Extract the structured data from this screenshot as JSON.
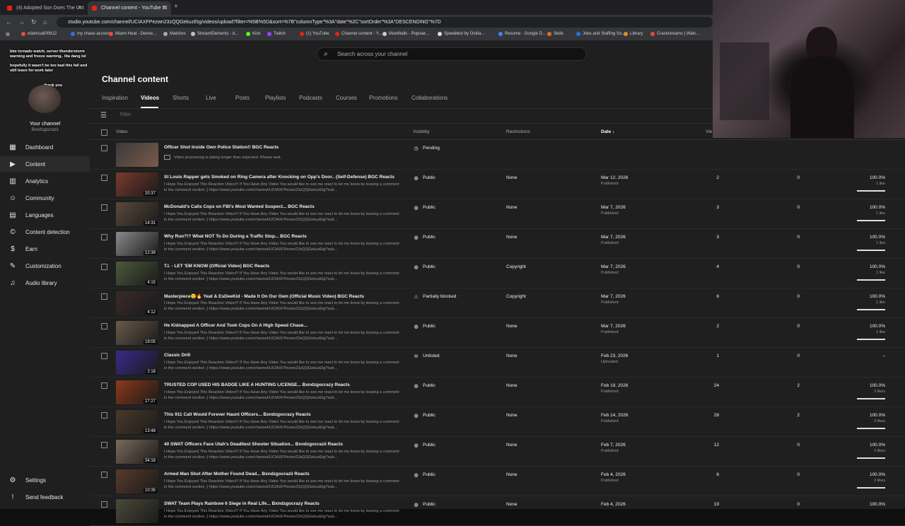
{
  "browser": {
    "tabs": [
      {
        "label": "(4) Adopted Son Does The Unt",
        "active": false
      },
      {
        "label": "Channel content - YouTube St",
        "active": true
      }
    ],
    "url": "studio.youtube.com/channel/UCIAXFPezwn23zQQGekuzEtg/videos/upload?filter=%5B%5D&sort=%7B\"columnType\"%3A\"date\"%2C\"sortOrder\"%3A\"DESCENDING\"%7D",
    "bookmarks": [
      "efabricati00912",
      "my chase account",
      "Miami Heat - Denve...",
      "Matches",
      "StreamElements - d...",
      "Kick",
      "Twitch",
      "(1) YouTube",
      "Channel content - Y...",
      "MoeWalls - Popular...",
      "Speedtest by Ookla...",
      "Resume - Google D...",
      "Skills",
      "Jobs and Staffing So...",
      "Library",
      "Crackstreams | Watc..."
    ]
  },
  "sidebar": {
    "channel_label": "Your channel",
    "channel_handle": "Bxndzgocrazii",
    "items": [
      {
        "label": "Dashboard",
        "icon": "dashboard-icon",
        "glyph": "▦"
      },
      {
        "label": "Content",
        "icon": "content-icon",
        "glyph": "▶",
        "active": true
      },
      {
        "label": "Analytics",
        "icon": "analytics-icon",
        "glyph": "▥"
      },
      {
        "label": "Community",
        "icon": "community-icon",
        "glyph": "☺"
      },
      {
        "label": "Languages",
        "icon": "languages-icon",
        "glyph": "▤"
      },
      {
        "label": "Content detection",
        "icon": "content-detection-icon",
        "glyph": "©"
      },
      {
        "label": "Earn",
        "icon": "earn-icon",
        "glyph": "$"
      },
      {
        "label": "Customization",
        "icon": "customization-icon",
        "glyph": "✎"
      },
      {
        "label": "Audio library",
        "icon": "audio-library-icon",
        "glyph": "♫"
      }
    ],
    "bottom_items": [
      {
        "label": "Settings",
        "icon": "settings-icon",
        "glyph": "⚙"
      },
      {
        "label": "Send feedback",
        "icon": "feedback-icon",
        "glyph": "!"
      }
    ]
  },
  "chat_overlay": [
    {
      "name": "",
      "text": "bbe tornado watch, server thunderstorm warning and freeze warning.. lita dang lol"
    },
    {
      "name": "",
      "text": "hopefully it wasn't be too bad this fall and still leave for work later"
    },
    {
      "name": "",
      "text": "thank you"
    }
  ],
  "search": {
    "placeholder": "Search across your channel"
  },
  "page_title": "Channel content",
  "content_tabs": [
    "Inspiration",
    "Videos",
    "Shorts",
    "Live",
    "Posts",
    "Playlists",
    "Podcasts",
    "Courses",
    "Promotions",
    "Collaborations"
  ],
  "active_tab": "Videos",
  "filter": {
    "placeholder": "Filter"
  },
  "columns": {
    "video": "Video",
    "visibility": "Visibility",
    "restrictions": "Restrictions",
    "date": "Date ↓",
    "views": "Vie"
  },
  "processing_row": {
    "title": "Officer Shot Inside Own Police Station!! BGC Reacts",
    "visibility": "Pending",
    "note": "Video processing is taking longer than expected. Please wait."
  },
  "videos": [
    {
      "title": "St Louis Rapper gets Smoked on Ring Camera after Knocking on Opp's Door.. (Self-Defense) BGC Reacts",
      "duration": "20:37",
      "visibility": "Public",
      "restrictions": "None",
      "date": "Mar 12, 2026",
      "date_sub": "Published",
      "views": "2",
      "comments": "0",
      "likes": "100.0%",
      "likes_sub": "1 like",
      "thumb": "#7a3a2e"
    },
    {
      "title": "McDonald's Calls Cops on FBI's Most Wanted Suspect... BGC Reacts",
      "duration": "14:31",
      "visibility": "Public",
      "restrictions": "None",
      "date": "Mar 7, 2026",
      "date_sub": "Published",
      "views": "3",
      "comments": "0",
      "likes": "100.0%",
      "likes_sub": "1 like",
      "thumb": "#5a4a3a"
    },
    {
      "title": "Why Run?!? What NOT To Do During a Traffic Stop... BGC Reacts",
      "duration": "12:39",
      "visibility": "Public",
      "restrictions": "None",
      "date": "Mar 7, 2026",
      "date_sub": "Published",
      "views": "3",
      "comments": "0",
      "likes": "100.0%",
      "likes_sub": "1 like",
      "thumb": "#8a8a8a"
    },
    {
      "title": "T.I. - LET 'EM KNOW (Official Video) BGC Reacts",
      "duration": "4:15",
      "visibility": "Public",
      "restrictions": "Copyright",
      "date": "Mar 7, 2026",
      "date_sub": "Published",
      "views": "4",
      "comments": "0",
      "likes": "100.0%",
      "likes_sub": "1 like",
      "thumb": "#4a5a3a"
    },
    {
      "title": "Masterpiece😌🔥 Yeat & EsDeeKid - Made It On Our Own (Official Music Video) BGC Reacts",
      "duration": "4:12",
      "visibility": "Partially blocked",
      "restrictions": "Copyright",
      "date": "Mar 7, 2026",
      "date_sub": "Published",
      "views": "6",
      "comments": "0",
      "likes": "100.0%",
      "likes_sub": "1 like",
      "thumb": "#3a2a2a",
      "warn": true
    },
    {
      "title": "He Kidnapped A Officer And Took Cops On A High Speed Chase...",
      "duration": "19:05",
      "visibility": "Public",
      "restrictions": "None",
      "date": "Mar 7, 2026",
      "date_sub": "Published",
      "views": "2",
      "comments": "0",
      "likes": "100.0%",
      "likes_sub": "1 like",
      "thumb": "#6a5a4a"
    },
    {
      "title": "Classic Drill",
      "duration": "2:18",
      "visibility": "Unlisted",
      "restrictions": "None",
      "date": "Feb 23, 2026",
      "date_sub": "Uploaded",
      "views": "1",
      "comments": "0",
      "likes": "–",
      "likes_sub": "",
      "thumb": "#3a2a8a",
      "unlisted": true
    },
    {
      "title": "TRUSTED COP USED HIS BADGE LIKE A HUNTING LICENSE... Bxndzgocrazy Reacts",
      "duration": "27:27",
      "visibility": "Public",
      "restrictions": "None",
      "date": "Feb 19, 2026",
      "date_sub": "Published",
      "views": "24",
      "comments": "2",
      "likes": "100.0%",
      "likes_sub": "3 likes",
      "thumb": "#8a3a1a"
    },
    {
      "title": "This 911 Call Would Forever Haunt Officers... Bxndzgocrazy Reacts",
      "duration": "13:48",
      "visibility": "Public",
      "restrictions": "None",
      "date": "Feb 14, 2026",
      "date_sub": "Published",
      "views": "28",
      "comments": "2",
      "likes": "100.0%",
      "likes_sub": "3 likes",
      "thumb": "#4a3a2a"
    },
    {
      "title": "40 SWAT Officers Face Utah's Deadliest Shooter Situation... Bxndzgocrazii Reacts",
      "duration": "34:18",
      "visibility": "Public",
      "restrictions": "None",
      "date": "Feb 7, 2026",
      "date_sub": "Published",
      "views": "12",
      "comments": "0",
      "likes": "100.0%",
      "likes_sub": "2 likes",
      "thumb": "#7a6a5a"
    },
    {
      "title": "Armed Man Shot After Mother Found Dead... Bxndzgocrazii Reacts",
      "duration": "10:35",
      "visibility": "Public",
      "restrictions": "None",
      "date": "Feb 4, 2026",
      "date_sub": "Published",
      "views": "6",
      "comments": "0",
      "likes": "100.0%",
      "likes_sub": "2 likes",
      "thumb": "#5a3a2a"
    },
    {
      "title": "SWAT Team Plays Rainbow 6 Siege in Real Life... Bxndzgocrazy Reacts",
      "duration": "",
      "visibility": "Public",
      "restrictions": "None",
      "date": "Feb 4, 2026",
      "date_sub": "",
      "views": "19",
      "comments": "0",
      "likes": "100.0%",
      "likes_sub": "",
      "thumb": "#4a4a3a"
    }
  ],
  "description": "I Hope You Enjoyed This Reaction Video!!! If You Have Any Video You would like to see me react to let me know by leaving a comment in the comment section ;) https://www.youtube.com/channel/UCIAXFPezwn23zQQGekuzEtg?sub..."
}
